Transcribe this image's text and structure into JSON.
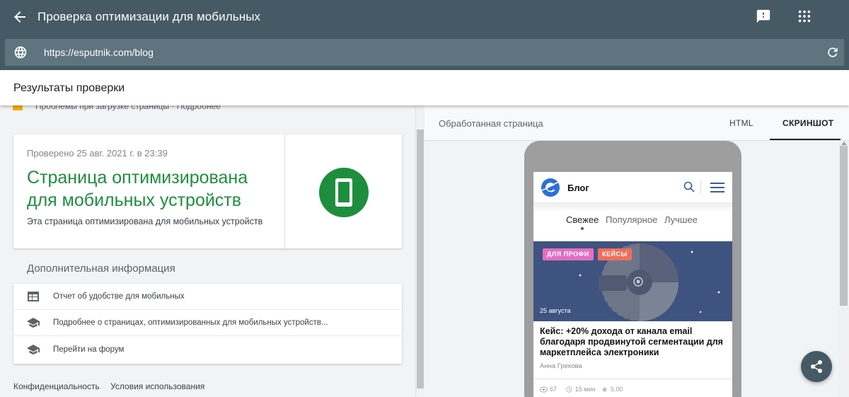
{
  "app": {
    "title": "Проверка оптимизации для мобильных",
    "url": "https://esputnik.com/blog"
  },
  "results": {
    "title": "Результаты проверки",
    "cut_row_text": "Проблемы при загрузке страницы · Подробнее"
  },
  "status": {
    "checked": "Проверено 25 авг. 2021 г. в 23:39",
    "headline": "Страница оптимизирована для мобильных устройств",
    "subtitle": "Эта страница оптимизирована для мобильных устройств",
    "color": "#1e8e3e"
  },
  "more_info": {
    "title": "Дополнительная информация",
    "items": [
      {
        "label": "Отчет об удобстве для мобильных",
        "icon": "web-report-icon"
      },
      {
        "label": "Подробнее о страницах, оптимизированных для мобильных устройств...",
        "icon": "school-icon"
      },
      {
        "label": "Перейти на форум",
        "icon": "school-icon"
      }
    ]
  },
  "footer": {
    "privacy": "Конфиденциальность",
    "terms": "Условия использования"
  },
  "preview": {
    "rendered_label": "Обработанная страница",
    "tab_html": "HTML",
    "tab_screenshot": "СКРИНШОТ"
  },
  "blog": {
    "title": "Блог",
    "tabs": [
      "Свежее",
      "Популярное",
      "Лучшее"
    ],
    "badge1": "ДЛЯ ПРОФИ",
    "badge2": "КЕЙСЫ",
    "date": "25 августа",
    "article_title": "Кейс: +20% дохода от канала email благодаря продвинутой сегментации для маркетплейса электроники",
    "author": "Анна Грекова",
    "views": "67",
    "read_time": "15 мин",
    "rating": "5.00"
  }
}
